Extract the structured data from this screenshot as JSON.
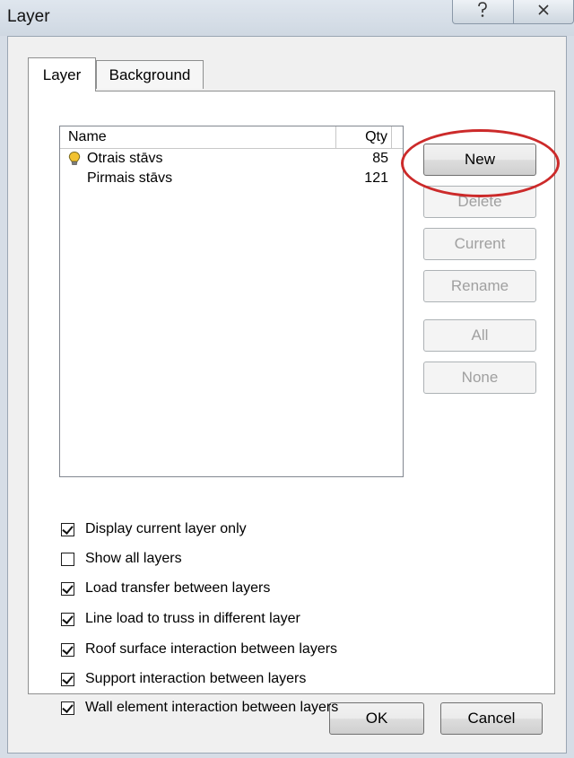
{
  "window": {
    "title": "Layer",
    "help_glyph": "ℹ",
    "close_glyph": "✕"
  },
  "tabs": [
    {
      "label": "Layer",
      "active": true
    },
    {
      "label": "Background",
      "active": false
    }
  ],
  "layer_list": {
    "columns": {
      "name": "Name",
      "qty": "Qty"
    },
    "rows": [
      {
        "name": "Otrais stāvs",
        "qty": "85",
        "current": true,
        "icon": "lightbulb-icon"
      },
      {
        "name": "Pirmais stāvs",
        "qty": "121",
        "current": false,
        "icon": ""
      }
    ]
  },
  "side_buttons": {
    "new": "New",
    "delete": "Delete",
    "current": "Current",
    "rename": "Rename",
    "all": "All",
    "none": "None"
  },
  "options": [
    {
      "label": "Display current layer only",
      "checked": true
    },
    {
      "label": "Show all layers",
      "checked": false
    },
    {
      "label": "Load transfer between layers",
      "checked": true
    },
    {
      "label": "Line load to truss in different layer",
      "checked": true
    },
    {
      "label": "Roof surface interaction between layers",
      "checked": true
    },
    {
      "label": "Support interaction between layers",
      "checked": true
    },
    {
      "label": "Wall element interaction between layers",
      "checked": true
    }
  ],
  "footer": {
    "ok": "OK",
    "cancel": "Cancel"
  },
  "colors": {
    "highlight_ring": "#cc2a2a",
    "bulb": "#f2c230"
  }
}
